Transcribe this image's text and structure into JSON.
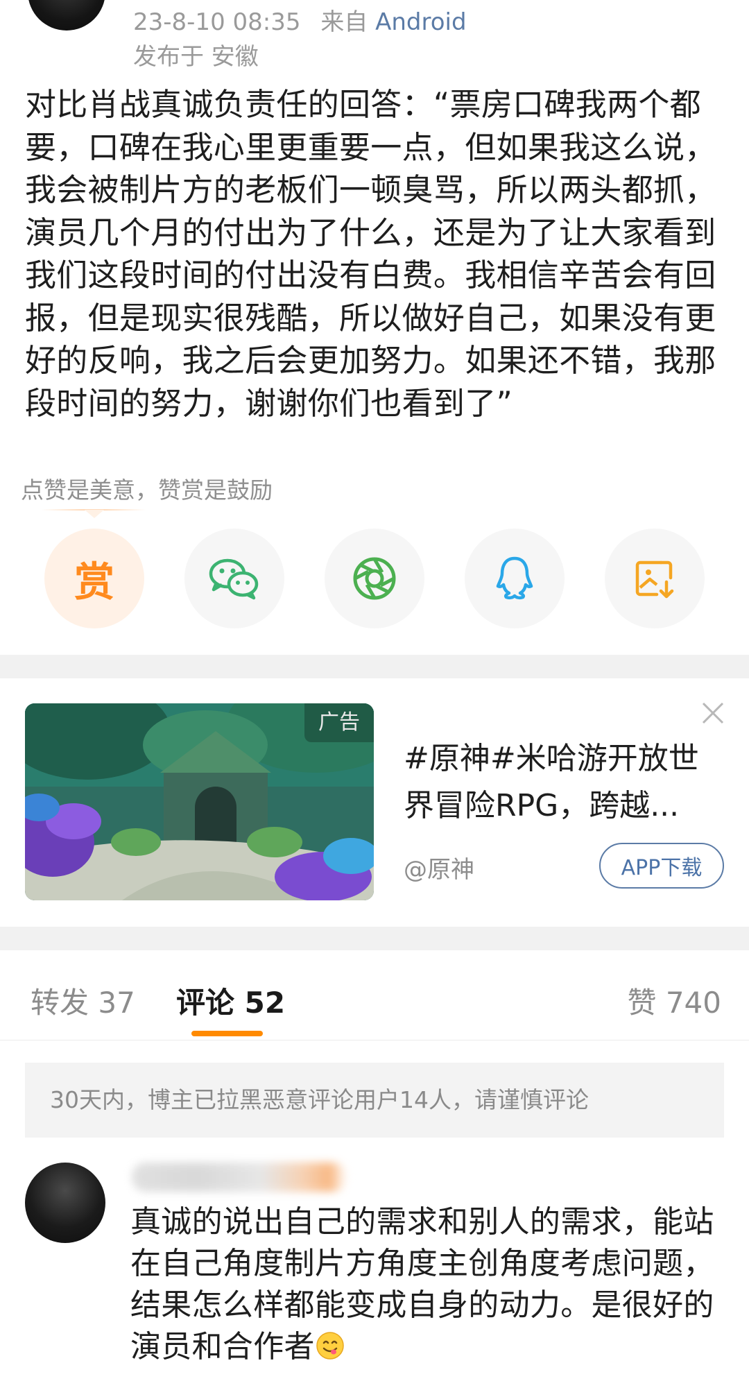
{
  "post": {
    "datetime": "23-8-10 08:35",
    "source_prefix": "来自",
    "source": "Android",
    "location": "发布于 安徽",
    "body": "对比肖战真诚负责任的回答：“票房口碑我两个都要，口碑在我心里更重要一点，但如果我这么说，我会被制片方的老板们一顿臭骂，所以两头都抓，演员几个月的付出为了什么，还是为了让大家看到我们这段时间的付出没有白费。我相信辛苦会有回报，但是现实很残酷，所以做好自己，如果没有更好的反响，我之后会更加努力。如果还不错，我那段时间的努力，谢谢你们也看到了”"
  },
  "reward": {
    "hint": "点赞是美意，赞赏是鼓励",
    "reward_char": "赏"
  },
  "share_icons": [
    "reward-icon",
    "wechat-icon",
    "moments-icon",
    "qq-icon",
    "save-image-icon"
  ],
  "ad": {
    "tag": "广告",
    "title": "#原神#米哈游开放世界冒险RPG，跨越...",
    "account": "@原神",
    "button": "APP下载"
  },
  "tabs": {
    "repost": "转发 37",
    "comments": "评论 52",
    "likes": "赞 740"
  },
  "notice": "30天内，博主已拉黑恶意评论用户14人，请谨慎评论",
  "comment": {
    "text": "真诚的说出自己的需求和别人的需求，能站在自己角度制片方角度主创角度考虑问题，结果怎么样都能变成自身的动力。是很好的演员和合作者"
  },
  "colors": {
    "accent_orange": "#ff8a00",
    "link_blue": "#5b7ba6",
    "wechat_green": "#3cb371",
    "qq_blue": "#2aa7e8",
    "save_orange": "#f5a623"
  }
}
